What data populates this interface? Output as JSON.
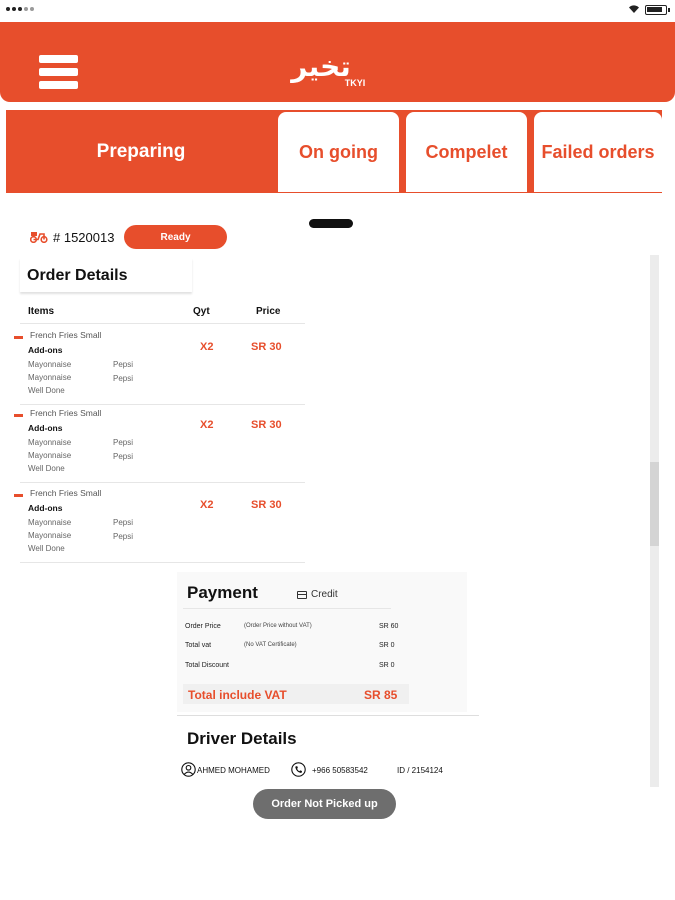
{
  "status_bar": {
    "signal": "signal-dots",
    "wifi": "wifi-icon",
    "battery": "battery-icon"
  },
  "header": {
    "logo_text": "تخير",
    "logo_sub": "TKYI"
  },
  "tabs": [
    {
      "label": "Preparing",
      "active": true
    },
    {
      "label": "On going"
    },
    {
      "label": "Compelet"
    },
    {
      "label": "Failed orders"
    }
  ],
  "order": {
    "number": "# 1520013",
    "status": "Ready"
  },
  "details": {
    "title": "Order Details",
    "columns": {
      "items": "Items",
      "qty": "Qyt",
      "price": "Price"
    },
    "items": [
      {
        "name": "French Fries Small",
        "addons_label": "Add-ons",
        "addons": [
          "Mayonnaise",
          "Pepsi",
          "Mayonnaise",
          "Pepsi",
          "Well Done"
        ],
        "qty": "X2",
        "price": "SR 30"
      },
      {
        "name": "French Fries Small",
        "addons_label": "Add-ons",
        "addons": [
          "Mayonnaise",
          "Pepsi",
          "Mayonnaise",
          "Pepsi",
          "Well Done"
        ],
        "qty": "X2",
        "price": "SR 30"
      },
      {
        "name": "French Fries Small",
        "addons_label": "Add-ons",
        "addons": [
          "Mayonnaise",
          "Pepsi",
          "Mayonnaise",
          "Pepsi",
          "Well Done"
        ],
        "qty": "X2",
        "price": "SR 30"
      }
    ]
  },
  "payment": {
    "title": "Payment",
    "method": "Credit",
    "rows": [
      {
        "label": "Order Price",
        "note": "(Order Price without VAT)",
        "value": "SR 60"
      },
      {
        "label": "Total vat",
        "note": "(No VAT Certificate)",
        "value": "SR 0"
      },
      {
        "label": "Total Discount",
        "note": "",
        "value": "SR 0"
      }
    ],
    "total_label": "Total include VAT",
    "total_value": "SR 85"
  },
  "driver": {
    "title": "Driver Details",
    "name": "AHMED MOHAMED",
    "phone": "+966 50583542",
    "id": "ID / 2154124",
    "button": "Order Not Picked up"
  },
  "colors": {
    "brand": "#e74e2c",
    "button_gray": "#6e6e6e"
  }
}
